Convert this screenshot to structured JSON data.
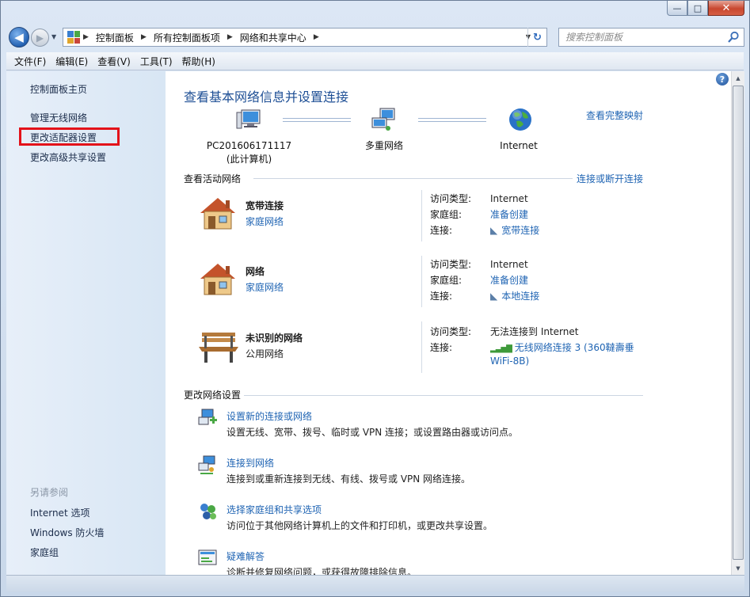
{
  "window": {
    "caption": {
      "minimize": "—",
      "maximize": "□",
      "close": "✕"
    }
  },
  "address": {
    "crumbs": [
      "控制面板",
      "所有控制面板项",
      "网络和共享中心"
    ],
    "search_placeholder": "搜索控制面板"
  },
  "menu": [
    "文件(F)",
    "编辑(E)",
    "查看(V)",
    "工具(T)",
    "帮助(H)"
  ],
  "sidebar": {
    "home": "控制面板主页",
    "links": [
      "管理无线网络",
      "更改适配器设置",
      "更改高级共享设置"
    ],
    "see_also_heading": "另请参阅",
    "see_also": [
      "Internet 选项",
      "Windows 防火墙",
      "家庭组"
    ]
  },
  "main": {
    "title": "查看基本网络信息并设置连接",
    "map_link": "查看完整映射",
    "nodes": {
      "pc_name": "PC201606171117",
      "pc_sub": "(此计算机)",
      "multi": "多重网络",
      "internet": "Internet"
    },
    "active_heading": "查看活动网络",
    "connect_link": "连接或断开连接",
    "networks": [
      {
        "name": "宽带连接",
        "type": "家庭网络",
        "type_is_link": true,
        "access_label": "访问类型:",
        "access": "Internet",
        "homegroup_label": "家庭组:",
        "homegroup": "准备创建",
        "conn_label": "连接:",
        "conn": "宽带连接"
      },
      {
        "name": "网络",
        "type": "家庭网络",
        "type_is_link": true,
        "access_label": "访问类型:",
        "access": "Internet",
        "homegroup_label": "家庭组:",
        "homegroup": "准备创建",
        "conn_label": "连接:",
        "conn": "本地连接"
      },
      {
        "name": "未识别的网络",
        "type": "公用网络",
        "type_is_link": false,
        "access_label": "访问类型:",
        "access": "无法连接到 Internet",
        "conn_label": "连接:",
        "conn": "无线网络连接 3 (360韃壽垂",
        "conn2": "WiFi-8B)"
      }
    ],
    "change_heading": "更改网络设置",
    "tasks": [
      {
        "link": "设置新的连接或网络",
        "desc": "设置无线、宽带、拨号、临时或 VPN 连接；或设置路由器或访问点。"
      },
      {
        "link": "连接到网络",
        "desc": "连接到或重新连接到无线、有线、拨号或 VPN 网络连接。"
      },
      {
        "link": "选择家庭组和共享选项",
        "desc": "访问位于其他网络计算机上的文件和打印机，或更改共享设置。"
      },
      {
        "link": "疑难解答",
        "desc": "诊断并修复网络问题，或获得故障排除信息。"
      }
    ],
    "help": "?"
  },
  "colors": {
    "link": "#1f64b3",
    "title": "#1e4f95",
    "highlight": "#e3121a"
  }
}
